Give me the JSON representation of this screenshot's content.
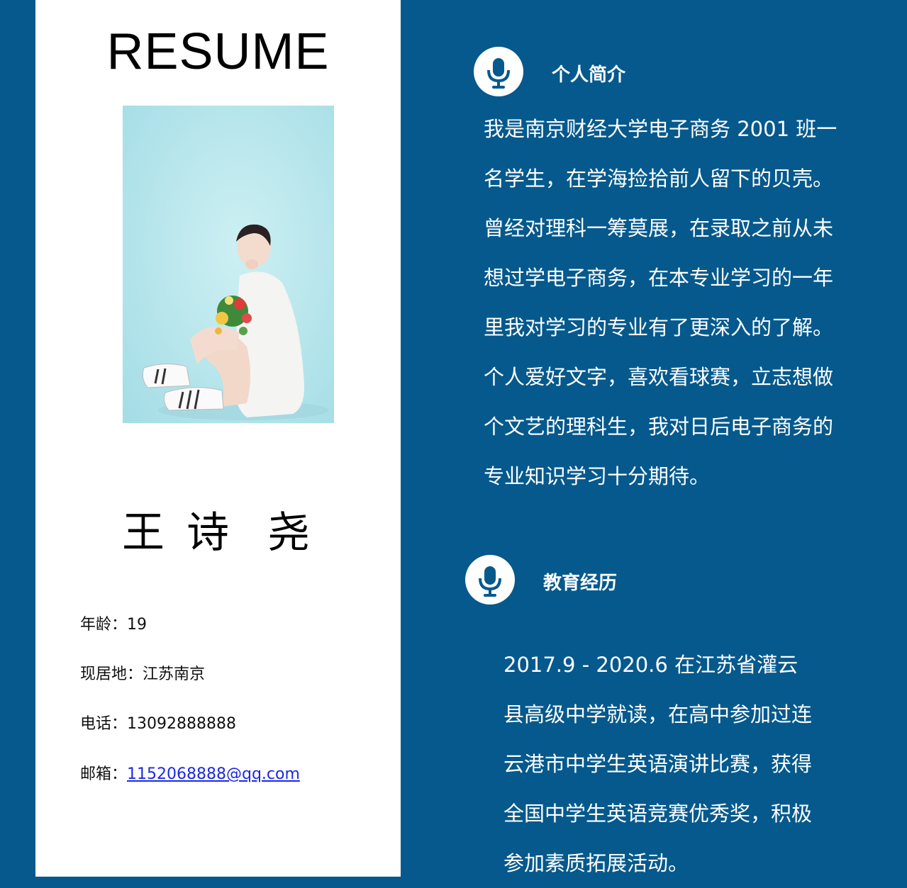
{
  "resume": {
    "title": "RESUME",
    "name_parts": [
      "王 诗",
      "尧"
    ],
    "info": {
      "age_label": "年龄：",
      "age_value": "19",
      "location_label": "现居地：",
      "location_value": "江苏南京",
      "phone_label": "电话：",
      "phone_value": "13092888888",
      "email_label": "邮箱：",
      "email_value": "1152068888@qq.com"
    }
  },
  "sections": {
    "intro": {
      "title": "个人简介",
      "icon": "microphone-icon",
      "lines": [
        "我是南京财经大学电子商务 2001 班一",
        "名学生，在学海捡拾前人留下的贝壳。",
        "曾经对理科一筹莫展，在录取之前从未",
        "想过学电子商务，在本专业学习的一年",
        "里我对学习的专业有了更深入的了解。",
        "个人爱好文字，喜欢看球赛，立志想做",
        "个文艺的理科生，我对日后电子商务的",
        "专业知识学习十分期待。"
      ]
    },
    "education": {
      "title": "教育经历",
      "icon": "microphone-icon",
      "lines": [
        "2017.9 - 2020.6 在江苏省灌云",
        "县高级中学就读，在高中参加过连",
        "云港市中学生英语演讲比赛，获得",
        "全国中学生英语竞赛优秀奖，积极",
        "参加素质拓展活动。"
      ]
    }
  },
  "colors": {
    "panel_blue": "#05598c",
    "link_blue": "#1a28e6",
    "photo_bg": "#bde9ee"
  }
}
